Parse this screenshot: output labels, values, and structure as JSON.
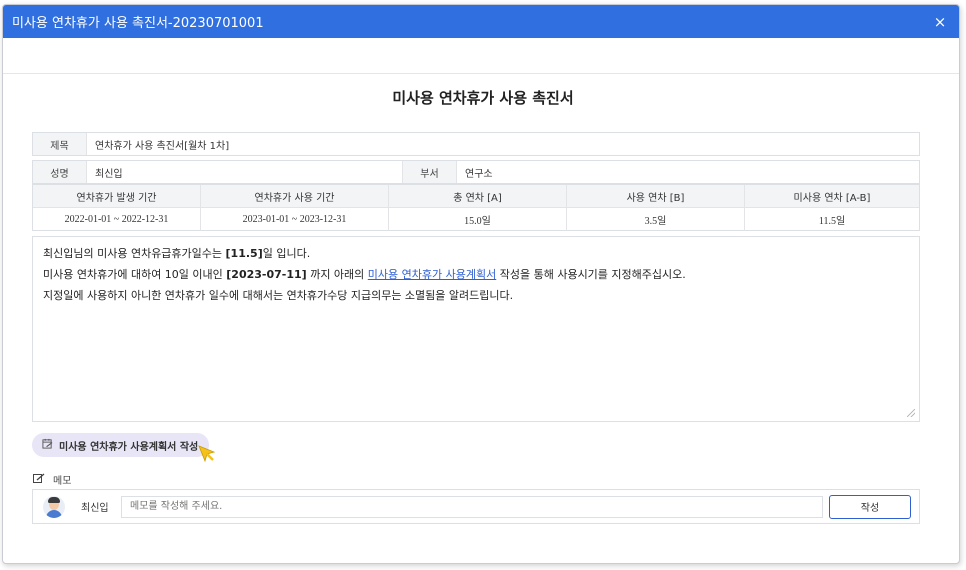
{
  "window": {
    "title": "미사용 연차휴가 사용 촉진서-20230701001",
    "close_icon": "×"
  },
  "doc": {
    "title": "미사용 연차휴가 사용 촉진서"
  },
  "form": {
    "subject_label": "제목",
    "subject_value": "연차휴가 사용 촉진서[월차 1차]",
    "name_label": "성명",
    "name_value": "최신입",
    "dept_label": "부서",
    "dept_value": "연구소"
  },
  "stats": {
    "headers": [
      "연차휴가 발생 기간",
      "연차휴가 사용 기간",
      "총 연차 [A]",
      "사용 연차 [B]",
      "미사용 연차 [A-B]"
    ],
    "values": [
      "2022-01-01 ~ 2022-12-31",
      "2023-01-01 ~ 2023-12-31",
      "15.0일",
      "3.5일",
      "11.5일"
    ]
  },
  "message": {
    "line1_a": "최신입님의 미사용 연차유급휴가일수는 ",
    "line1_b": "[11.5]",
    "line1_c": "일 입니다.",
    "line2_a": "미사용 연차휴가에 대하여 10일 이내인 ",
    "line2_b": "[2023-07-11]",
    "line2_c": " 까지 아래의 ",
    "line2_link": "미사용 연차휴가 사용계획서",
    "line2_d": " 작성을 통해 사용시기를 지정해주십시오.",
    "line3": "지정일에 사용하지 아니한 연차휴가 일수에 대해서는 연차휴가수당 지급의무는 소멸됨을 알려드립니다."
  },
  "plan_button": {
    "label": "미사용 연차휴가 사용계획서 작성",
    "icon": "calendar-edit-icon"
  },
  "memo": {
    "label": "메모",
    "icon": "memo-edit-icon",
    "user": "최신입",
    "placeholder": "메모를 작성해 주세요.",
    "submit_label": "작성"
  },
  "colors": {
    "titlebar": "#2f6fe0",
    "link": "#2f5fd0",
    "plan_button_bg": "#e7e5f6",
    "cursor": "#f4c21a"
  }
}
